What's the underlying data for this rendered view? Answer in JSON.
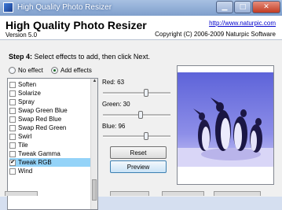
{
  "window": {
    "title": "High Quality Photo Resizer",
    "controls": [
      "minimize",
      "maximize",
      "close"
    ]
  },
  "header": {
    "app_title": "High Quality Photo Resizer",
    "version": "Version 5.0",
    "website": "http://www.naturpic.com",
    "copyright": "Copyright (C) 2006-2009 Naturpic Software"
  },
  "step": {
    "label": "Step 4:",
    "instruction": "Select effects to add, then click Next."
  },
  "mode": {
    "options": [
      "No effect",
      "Add effects"
    ],
    "selected": "Add effects"
  },
  "effects": [
    {
      "label": "Soften",
      "checked": false
    },
    {
      "label": "Solarize",
      "checked": false
    },
    {
      "label": "Spray",
      "checked": false
    },
    {
      "label": "Swap Green Blue",
      "checked": false
    },
    {
      "label": "Swap Red Blue",
      "checked": false
    },
    {
      "label": "Swap Red Green",
      "checked": false
    },
    {
      "label": "Swirl",
      "checked": false
    },
    {
      "label": "Tile",
      "checked": false
    },
    {
      "label": "Tweak Gamma",
      "checked": false
    },
    {
      "label": "Tweak RGB",
      "checked": true,
      "selected": true
    },
    {
      "label": "Wind",
      "checked": false
    }
  ],
  "sliders": {
    "red": {
      "label": "Red: 63",
      "value": 63
    },
    "green": {
      "label": "Green: 30",
      "value": 30
    },
    "blue": {
      "label": "Blue: 96",
      "value": 96
    }
  },
  "buttons": {
    "reset": "Reset",
    "preview": "Preview"
  },
  "colors": {
    "selection": "#94d3f8",
    "link": "#0000cc",
    "preview_sky": "#7b7fe0"
  }
}
